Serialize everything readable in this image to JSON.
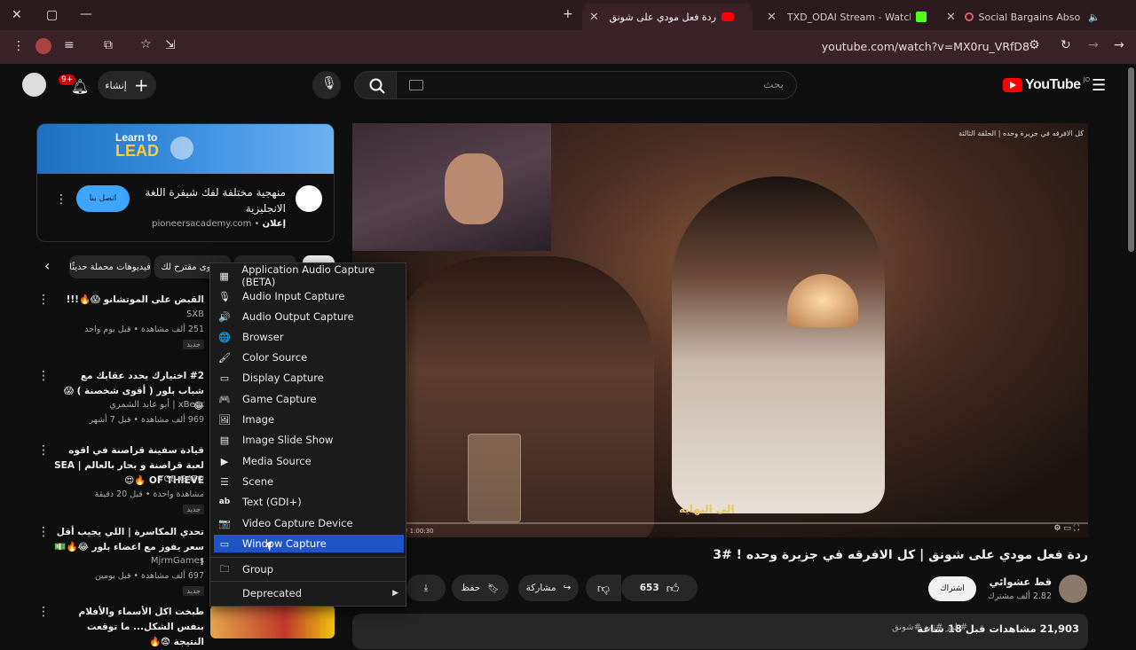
{
  "browser": {
    "tabs": [
      {
        "title": "ردة فعل مودي على شونق (43)",
        "active": true
      },
      {
        "title": "TXD_ODAI Stream - Watch Live",
        "active": false
      },
      {
        "title": "Social Bargains Absorb Insi",
        "active": false
      }
    ],
    "url": "youtube.com/watch?v=MX0ru_VRfD8"
  },
  "header": {
    "search_placeholder": "بحث",
    "create_label": "إنشاء",
    "notif_count": "9+",
    "logo_text": "YouTube",
    "country": "JO"
  },
  "ad": {
    "banner_line1": "Learn to",
    "banner_line2": "LEAD",
    "title": "منهجية مختلفة لفك شيفرة اللغة الانجليزية",
    "label": "إعلان",
    "domain": "pioneersacademy.com",
    "cta": "اتصل بنا"
  },
  "chips": [
    {
      "label": "فيديوهات محملة حديثًا"
    },
    {
      "label": "محتوى مقترح لك"
    }
  ],
  "recommendations": [
    {
      "title": "القبض على الموتشانو 😱🔥!!!",
      "channel": "SXB",
      "meta": "251 ألف مشاهدة • قبل يوم واحد",
      "badge": "جديد"
    },
    {
      "title": "#2 اختيارك يحدد عقابك مع شباب بلور ( أقوى شخصنة ) 😱😂",
      "channel": "أبو عابد الشمري | xBear",
      "meta": "969 ألف مشاهدة • قبل 7 أشهر",
      "badge": ""
    },
    {
      "title": "قيادة سفينة قراصنة في اقوه لعبة قراصنة و بحار بالعالم | SEA OF THIEVE 🔥😍",
      "channel": "TGB GATO",
      "meta": "مشاهدة واحدة • قبل 20 دقيقة",
      "badge": "جديد"
    },
    {
      "title": "تحدي المكاسرة | اللي يجيب أقل سعر يفوز مع اعضاء بلور 😂🔥💵 !",
      "channel": "MjrmGames",
      "meta": "697 ألف مشاهدة • قبل يومين",
      "badge": "جديد"
    },
    {
      "title": "طبخت اكل الأسماء والأفلام بنفس الشكل... ما توقعت النتيجة 😨🔥",
      "channel": "",
      "meta": "",
      "badge": ""
    }
  ],
  "context_menu": {
    "items": [
      {
        "label": "Application Audio Capture (BETA)",
        "icon": "app-audio-icon",
        "glyph": "▦"
      },
      {
        "label": "Audio Input Capture",
        "icon": "microphone-icon",
        "glyph": "🎙"
      },
      {
        "label": "Audio Output Capture",
        "icon": "speaker-icon",
        "glyph": "🔊"
      },
      {
        "label": "Browser",
        "icon": "globe-icon",
        "glyph": "🌐"
      },
      {
        "label": "Color Source",
        "icon": "brush-icon",
        "glyph": "🖌"
      },
      {
        "label": "Display Capture",
        "icon": "monitor-icon",
        "glyph": "▭"
      },
      {
        "label": "Game Capture",
        "icon": "gamepad-icon",
        "glyph": "🎮"
      },
      {
        "label": "Image",
        "icon": "image-icon",
        "glyph": "🖼"
      },
      {
        "label": "Image Slide Show",
        "icon": "slideshow-icon",
        "glyph": "▤"
      },
      {
        "label": "Media Source",
        "icon": "play-icon",
        "glyph": "▶"
      },
      {
        "label": "Scene",
        "icon": "list-icon",
        "glyph": "☰"
      },
      {
        "label": "Text (GDI+)",
        "icon": "text-icon",
        "glyph": "ab"
      },
      {
        "label": "Video Capture Device",
        "icon": "camera-icon",
        "glyph": "📷"
      },
      {
        "label": "Window Capture",
        "icon": "window-icon",
        "glyph": "▭"
      }
    ],
    "group_label": "Group",
    "deprecated_label": "Deprecated"
  },
  "video": {
    "overlay_title": "كل الافرقه في جزيرة وحده | الحلقة الثالثة",
    "subtitle": "الى النهايه",
    "time": "/ 1:00:30",
    "title": "ردة فعل مودي على شونق | كل الافرقه في جزيرة وحده ! #3",
    "channel": "قط عشوائي",
    "subs": "2.82 ألف مشترك",
    "subscribe": "اشتراك",
    "likes": "653",
    "share": "مشاركة",
    "save": "حفظ",
    "views": "21,903 مشاهدات",
    "age": "قبل 18 ساعة",
    "tags": "#بلور #زيد #شونق"
  },
  "colors": {
    "accent_blue": "#3ea6ff",
    "menu_selected": "#1f54c8",
    "youtube_red": "#ff0000"
  }
}
